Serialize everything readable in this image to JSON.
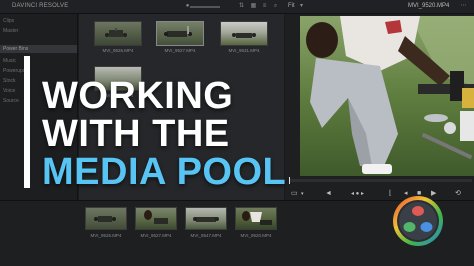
{
  "topbar": {
    "app_name": "DAVINCI RESOLVE",
    "fit_label": "Fit",
    "clip_title": "MVI_9520.MP4"
  },
  "sidebar": {
    "items": [
      "Clips",
      "Master",
      "Music",
      "Powerups",
      "Stock",
      "Voice",
      "Source"
    ],
    "selected": "Power Bins"
  },
  "pool": {
    "clips": [
      {
        "name": "MVI_9526.MP4"
      },
      {
        "name": "MVI_9527.MP4"
      },
      {
        "name": "MVI_9531.MP4"
      },
      {
        "name": "MVI_9532.MP4"
      }
    ]
  },
  "overlay": {
    "line1": "WORKING",
    "line2": "WITH THE",
    "line3": "MEDIA POOL"
  },
  "strip": {
    "clips": [
      {
        "name": "MVI_9526.MP4"
      },
      {
        "name": "MVI_9527.MP4"
      },
      {
        "name": "MVI_9547.MP4"
      },
      {
        "name": "MVI_9520.MP4"
      }
    ]
  },
  "colors": {
    "accent_blue": "#58c4f3",
    "title_white": "#ffffff",
    "panel_bg": "#26272a"
  },
  "icons": [
    "grid-view-icon",
    "list-view-icon",
    "search-icon",
    "play-icon",
    "loop-icon",
    "volume-icon",
    "resolve-logo"
  ]
}
